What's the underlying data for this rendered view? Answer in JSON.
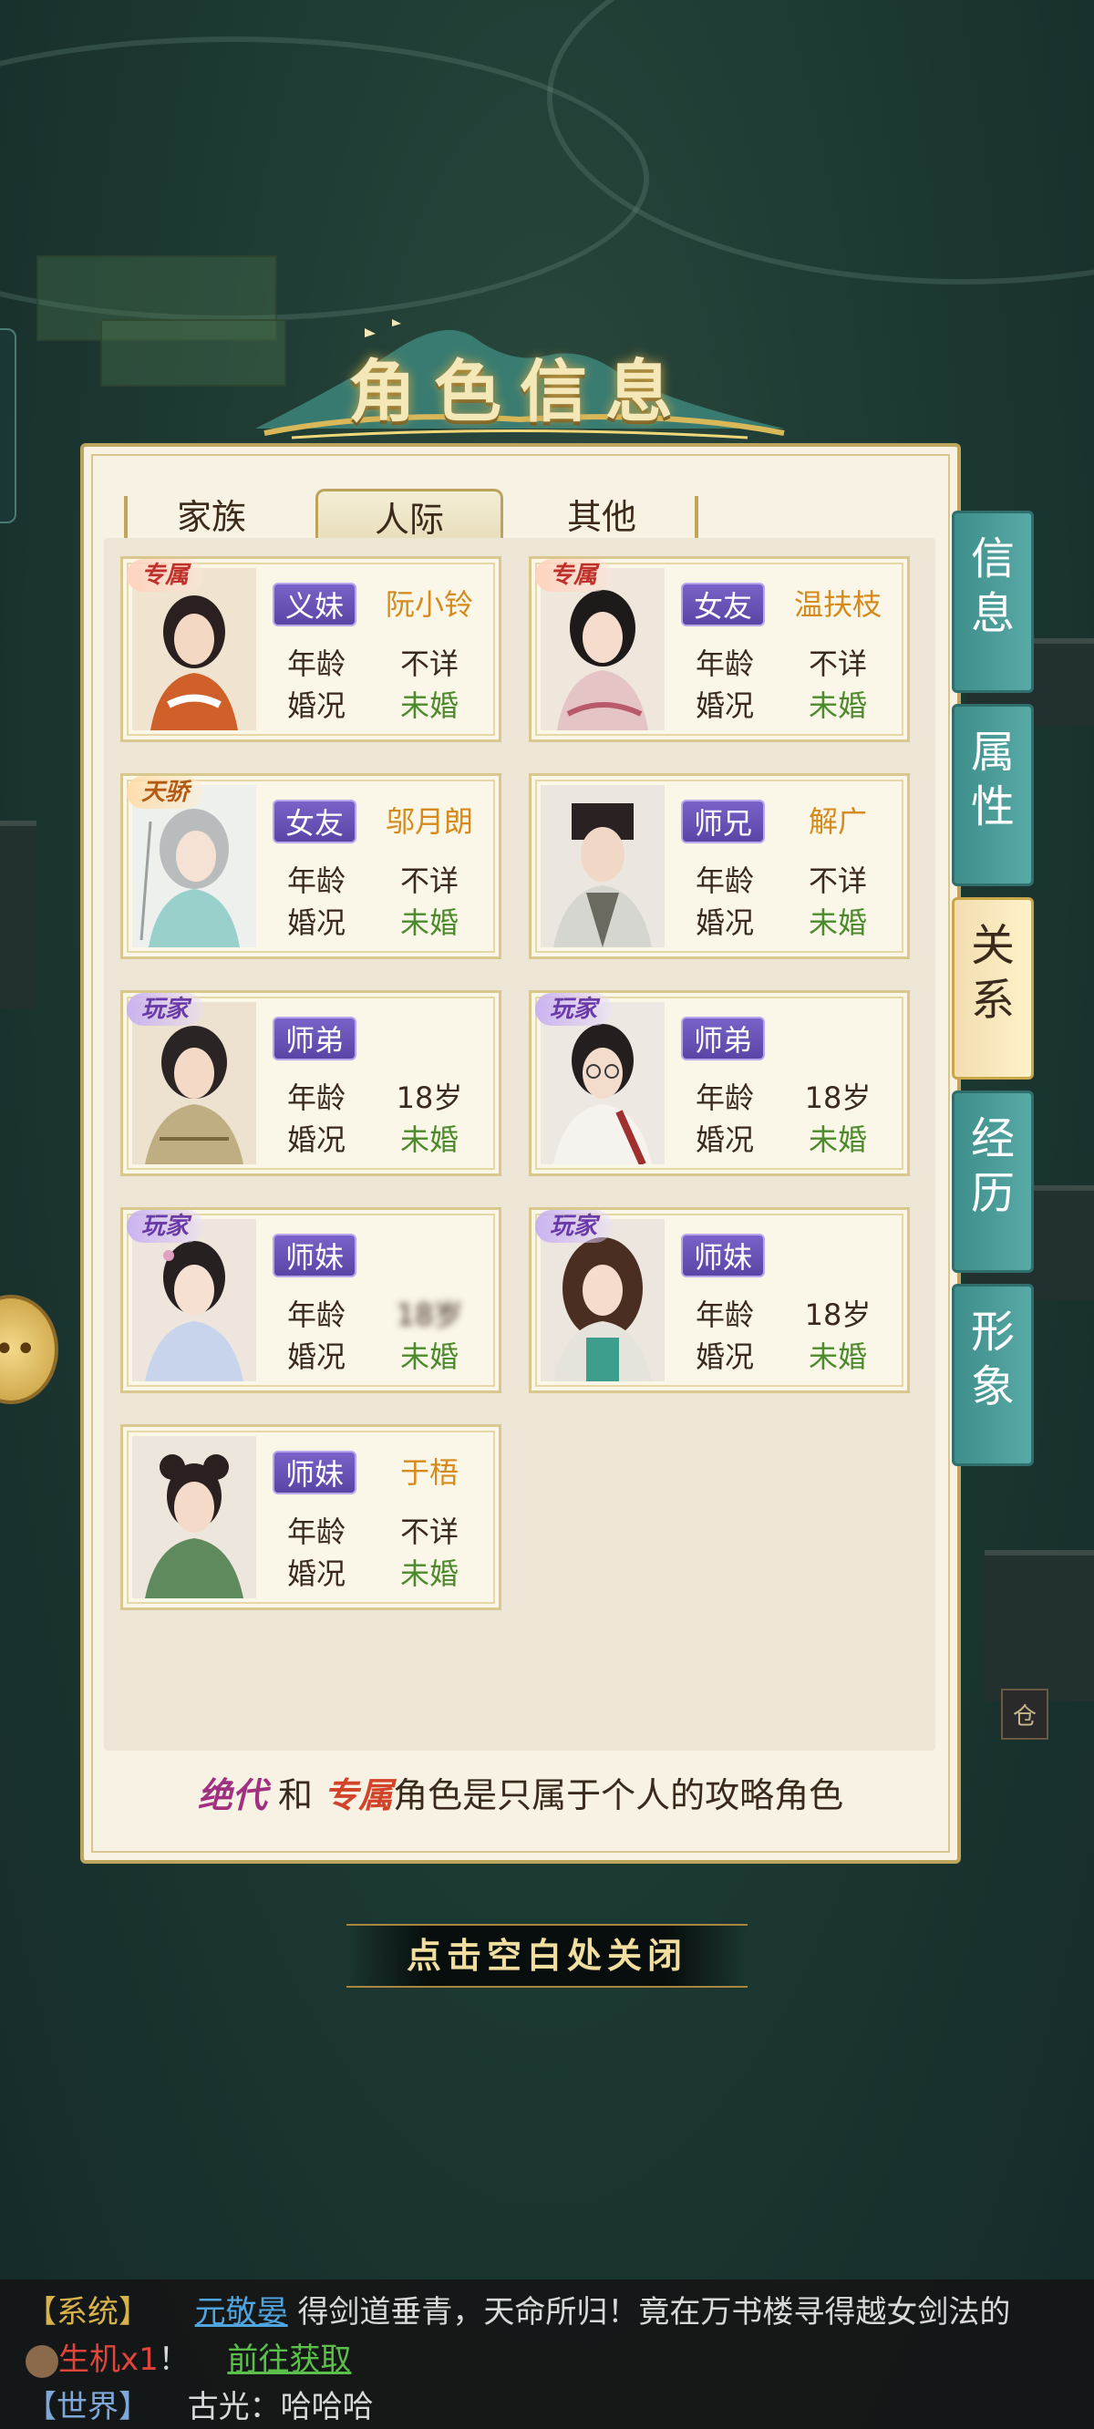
{
  "window_title": "角色信息",
  "tabs": [
    {
      "label": "家族",
      "active": false
    },
    {
      "label": "人际",
      "active": true
    },
    {
      "label": "其他",
      "active": false
    }
  ],
  "side_tabs": [
    {
      "label": "信\n息",
      "active": false
    },
    {
      "label": "属\n性",
      "active": false
    },
    {
      "label": "关\n系",
      "active": true
    },
    {
      "label": "经\n历",
      "active": false
    },
    {
      "label": "形\n象",
      "active": false
    }
  ],
  "labels": {
    "age": "年龄",
    "marriage": "婚况"
  },
  "relations": [
    {
      "tag": "专属",
      "tag_style": "zs",
      "relation": "义妹",
      "name": "阮小铃",
      "age": "不详",
      "marriage": "未婚",
      "name_blurred": false
    },
    {
      "tag": "专属",
      "tag_style": "zs",
      "relation": "女友",
      "name": "温扶枝",
      "age": "不详",
      "marriage": "未婚",
      "name_blurred": false
    },
    {
      "tag": "天骄",
      "tag_style": "tj",
      "relation": "女友",
      "name": "邬月朗",
      "age": "不详",
      "marriage": "未婚",
      "name_blurred": false
    },
    {
      "tag": "",
      "tag_style": "",
      "relation": "师兄",
      "name": "解广",
      "age": "不详",
      "marriage": "未婚",
      "name_blurred": false
    },
    {
      "tag": "玩家",
      "tag_style": "wj",
      "relation": "师弟",
      "name": "",
      "age": "18岁",
      "marriage": "未婚",
      "name_blurred": true
    },
    {
      "tag": "玩家",
      "tag_style": "wj",
      "relation": "师弟",
      "name": "",
      "age": "18岁",
      "marriage": "未婚",
      "name_blurred": true
    },
    {
      "tag": "玩家",
      "tag_style": "wj",
      "relation": "师妹",
      "name": "",
      "age": "18岁",
      "marriage": "未婚",
      "name_blurred": true
    },
    {
      "tag": "玩家",
      "tag_style": "wj",
      "relation": "师妹",
      "name": "",
      "age": "18岁",
      "marriage": "未婚",
      "name_blurred": true
    },
    {
      "tag": "",
      "tag_style": "",
      "relation": "师妹",
      "name": "于梧",
      "age": "不详",
      "marriage": "未婚",
      "name_blurred": false
    }
  ],
  "footnote": {
    "tag1": "绝代",
    "and": "和",
    "tag2": "专属",
    "rest": "角色是只属于个人的攻略角色"
  },
  "close_hint": "点击空白处关闭",
  "chat": [
    {
      "channel": "【系统】",
      "player": "元敬晏",
      "text": "得剑道垂青，天命所归！竟在万书楼寻得越女剑法的"
    },
    {
      "item": "生机x1",
      "text_after": "！",
      "link": "前往获取"
    },
    {
      "channel": "【世界】",
      "text": "古光：哈哈哈"
    }
  ],
  "map_marker": "仓",
  "colors": {
    "accent_gold": "#bda55d",
    "badge_purple": "#6a52b8",
    "name_orange": "#d68a1c",
    "status_green": "#4c8a2c",
    "side_tab_teal": "#4a9e9a"
  }
}
